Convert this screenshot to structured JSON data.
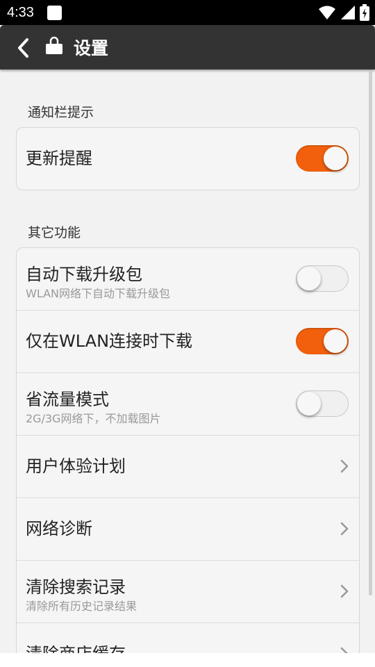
{
  "status_bar": {
    "time": "4:33",
    "icons": [
      "notification-icon",
      "wifi-icon",
      "signal-icon",
      "battery-icon"
    ]
  },
  "header": {
    "title": "设置",
    "icons": [
      "back-arrow-icon",
      "store-bag-icon"
    ]
  },
  "sections": [
    {
      "label": "通知栏提示",
      "items": [
        {
          "title": "更新提醒",
          "control": "toggle",
          "on": true
        }
      ]
    },
    {
      "label": "其它功能",
      "items": [
        {
          "title": "自动下载升级包",
          "subtitle": "WLAN网络下自动下载升级包",
          "control": "toggle",
          "on": false
        },
        {
          "title": "仅在WLAN连接时下载",
          "control": "toggle",
          "on": true
        },
        {
          "title": "省流量模式",
          "subtitle": "2G/3G网络下，不加载图片",
          "control": "toggle",
          "on": false
        },
        {
          "title": "用户体验计划",
          "control": "chevron"
        },
        {
          "title": "网络诊断",
          "control": "chevron"
        },
        {
          "title": "清除搜索记录",
          "subtitle": "清除所有历史记录结果",
          "control": "chevron"
        },
        {
          "title": "清除商店缓存",
          "control": "chevron"
        }
      ]
    }
  ],
  "colors": {
    "accent": "#f2600d",
    "action_bar": "#333333",
    "background": "#f2f2f2"
  }
}
